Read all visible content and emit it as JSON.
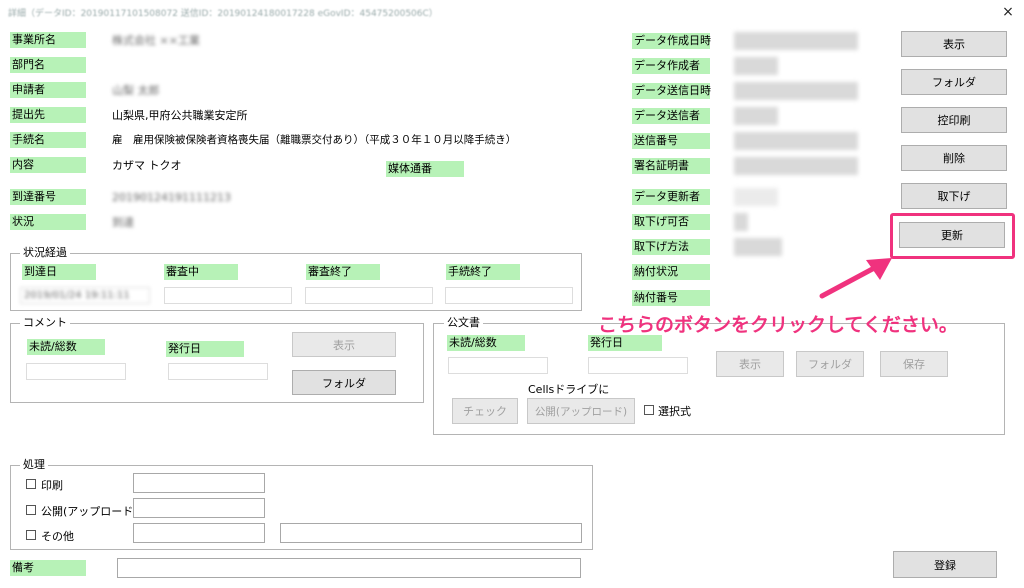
{
  "window": {
    "title": "詳細（データID：20190117101508072 送信ID：20190124180017228 eGovID：45475200506C）",
    "close_glyph": "×"
  },
  "left_fields": [
    {
      "label": "事業所名",
      "value": "株式会社 ××工業"
    },
    {
      "label": "部門名",
      "value": ""
    },
    {
      "label": "申請者",
      "value": "山梨 太郎"
    },
    {
      "label": "提出先",
      "value": "山梨県,甲府公共職業安定所"
    },
    {
      "label": "手続名",
      "value": "雇　雇用保険被保険者資格喪失届（離職票交付あり）（平成３０年１０月以降手続き）"
    },
    {
      "label": "内容",
      "value": "カザマ トクオ"
    },
    {
      "label": "到達番号",
      "value": "20190124191111213"
    },
    {
      "label": "状況",
      "value": "到達"
    }
  ],
  "media": {
    "label": "媒体通番",
    "value": ""
  },
  "right_fields": [
    {
      "label": "データ作成日時"
    },
    {
      "label": "データ作成者"
    },
    {
      "label": "データ送信日時"
    },
    {
      "label": "データ送信者"
    },
    {
      "label": "送信番号"
    },
    {
      "label": "署名証明書"
    },
    {
      "label": "データ更新者"
    },
    {
      "label": "取下げ可否"
    },
    {
      "label": "取下げ方法"
    },
    {
      "label": "納付状況"
    },
    {
      "label": "納付番号"
    }
  ],
  "side_buttons": {
    "show": "表示",
    "folder": "フォルダ",
    "receipt_print": "控印刷",
    "delete": "削除",
    "withdraw": "取下げ",
    "update": "更新",
    "register": "登録"
  },
  "status_history": {
    "title": "状況経過",
    "columns": [
      "到達日",
      "審査中",
      "審査終了",
      "手続終了"
    ],
    "values": [
      "2019/01/24 19:11:11",
      "",
      "",
      ""
    ]
  },
  "comment": {
    "title": "コメント",
    "unread_label": "未読/総数",
    "issue_date_label": "発行日",
    "show_button": "表示",
    "folder_button": "フォルダ"
  },
  "official_doc": {
    "title": "公文書",
    "unread_label": "未読/総数",
    "issue_date_label": "発行日",
    "show_button": "表示",
    "folder_button": "フォルダ",
    "save_button": "保存",
    "cells_drive_label": "Cellsドライブに",
    "check_button": "チェック",
    "publish_button": "公開(アップロード)",
    "select_label": "選択式"
  },
  "processing": {
    "title": "処理",
    "options": [
      "印刷",
      "公開(アップロード)",
      "その他"
    ]
  },
  "remarks": {
    "label": "備考",
    "value": ""
  },
  "annotation": {
    "text": "こちらのボタンをクリックしてください。",
    "color": "#f0327e"
  }
}
